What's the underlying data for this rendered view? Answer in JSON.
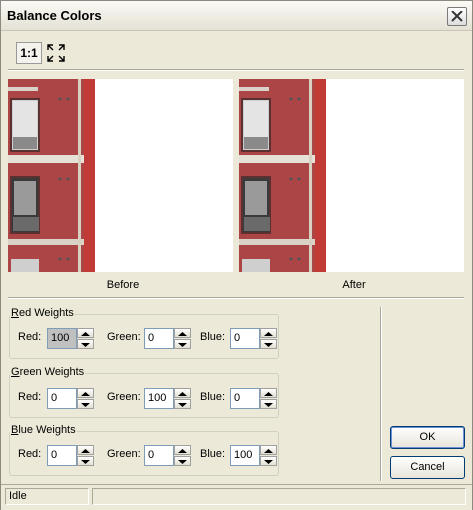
{
  "window": {
    "title": "Balance Colors"
  },
  "toolbar": {
    "actual_size_label": "1:1",
    "fit_icon": "fit-to-window-icon"
  },
  "preview": {
    "before_label": "Before",
    "after_label": "After"
  },
  "groups": {
    "red": {
      "title": "Red Weights",
      "red": "100",
      "green": "0",
      "blue": "0"
    },
    "green": {
      "title": "Green Weights",
      "red": "0",
      "green": "100",
      "blue": "0"
    },
    "blue": {
      "title": "Blue Weights",
      "red": "0",
      "green": "0",
      "blue": "100"
    }
  },
  "labels": {
    "red": "Red:",
    "green": "Green:",
    "blue": "Blue:"
  },
  "buttons": {
    "ok": "OK",
    "cancel": "Cancel"
  },
  "status": {
    "text": "Idle",
    "secondary": ""
  }
}
